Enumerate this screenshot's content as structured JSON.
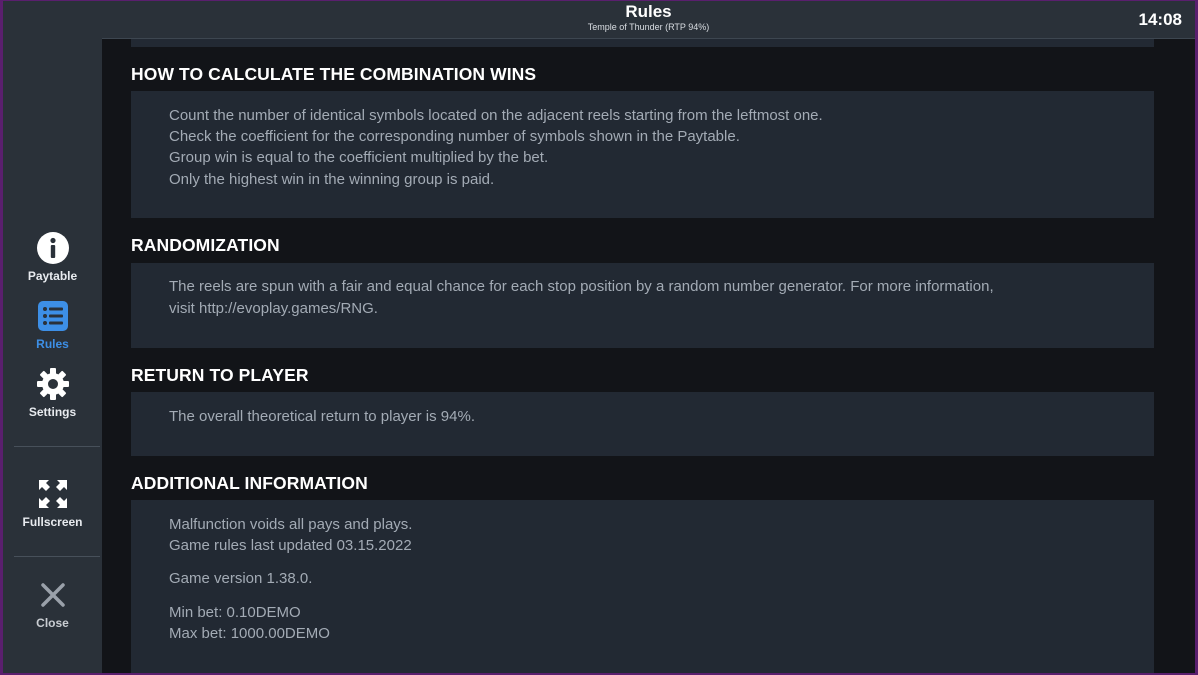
{
  "header": {
    "title": "Rules",
    "subtitle": "Temple of Thunder (RTP 94%)",
    "clock": "14:08"
  },
  "sidebar": {
    "items": [
      {
        "label": "Paytable",
        "icon": "info-icon"
      },
      {
        "label": "Rules",
        "icon": "list-icon",
        "active": true
      },
      {
        "label": "Settings",
        "icon": "gear-icon"
      },
      {
        "label": "Fullscreen",
        "icon": "fullscreen-icon"
      },
      {
        "label": "Close",
        "icon": "close-icon"
      }
    ]
  },
  "sections": {
    "combo": {
      "title": "HOW TO CALCULATE THE COMBINATION WINS",
      "lines": [
        "Count the number of identical symbols located on the adjacent reels starting from the leftmost one.",
        "Check the coefficient for the corresponding number of symbols shown in the Paytable.",
        "Group win is equal to the coefficient multiplied by the bet.",
        "Only the highest win in the winning group is paid."
      ]
    },
    "random": {
      "title": "RANDOMIZATION",
      "lines": [
        "The reels are spun with a fair and equal chance for each stop position by a random number generator. For more information,",
        "visit http://evoplay.games/RNG."
      ]
    },
    "rtp": {
      "title": "RETURN TO PLAYER",
      "lines": [
        "The overall theoretical return to player is 94%."
      ]
    },
    "additional": {
      "title": "ADDITIONAL INFORMATION",
      "lines": [
        "Malfunction voids all pays and plays.",
        "Game rules last updated 03.15.2022",
        "Game version 1.38.0.",
        "Min bet: 0.10DEMO",
        "Max bet: 1000.00DEMO"
      ]
    }
  },
  "colors": {
    "accent": "#3d8fe6",
    "panel": "#2a3139",
    "box": "#222933",
    "text_muted": "#a3abb5"
  }
}
